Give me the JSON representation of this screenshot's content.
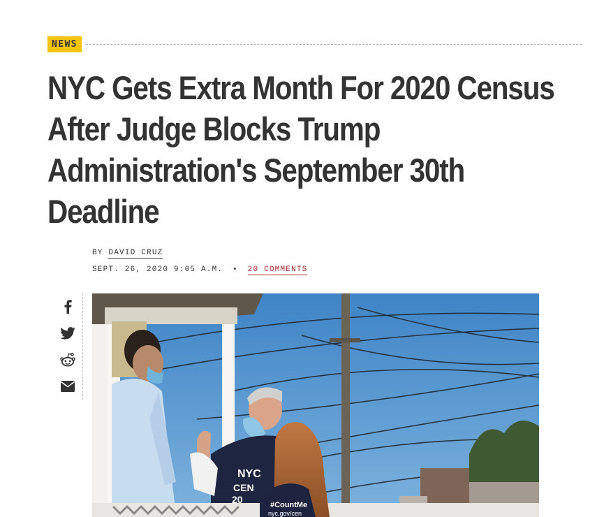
{
  "section": {
    "tag": "NEWS"
  },
  "article": {
    "headline": "NYC Gets Extra Month For 2020 Census After Judge Blocks Trump Administration's September 30th Deadline",
    "byline_prefix": "BY",
    "author": "DAVID CRUZ",
    "date": "SEPT. 26, 2020 9:05 A.M.",
    "separator": "•",
    "comments": "20 COMMENTS"
  },
  "share": {
    "icons": [
      "facebook-icon",
      "twitter-icon",
      "reddit-icon",
      "email-icon"
    ]
  },
  "photo": {
    "shirt_text_1": "NYC",
    "shirt_text_2": "CEN",
    "shirt_text_3": "20",
    "shirt_text_4": "#CountMe",
    "shirt_text_5": "nyc.gov/cen"
  },
  "colors": {
    "tag_bg": "#f7c410",
    "comments_link": "#a4242a",
    "text": "#333333",
    "sky": "#4f8ec9"
  }
}
